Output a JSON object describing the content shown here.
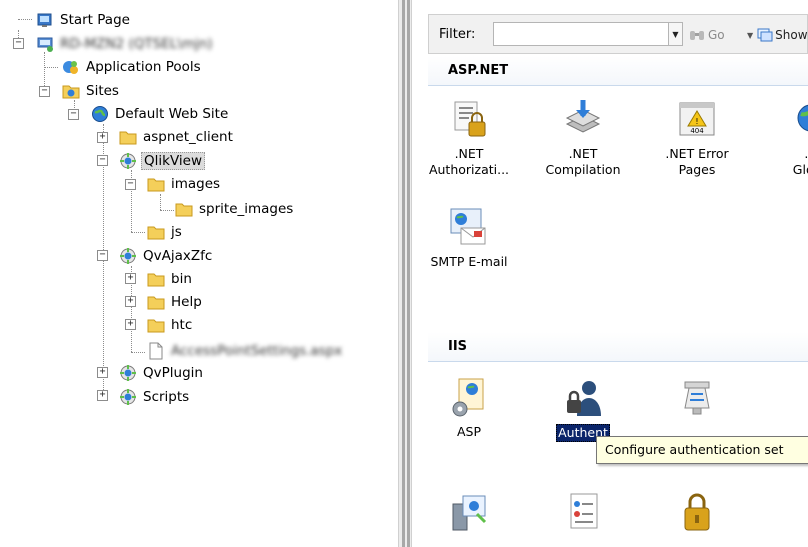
{
  "tree": {
    "items": [
      {
        "label": "Start Page",
        "icon": "start-page-icon"
      },
      {
        "label": "RD-MZN2 (QTSEL\\mjn)",
        "icon": "server-icon",
        "blurred": true
      },
      {
        "label": "Application Pools",
        "icon": "app-pools-icon"
      },
      {
        "label": "Sites",
        "icon": "sites-folder-icon"
      },
      {
        "label": "Default Web Site",
        "icon": "globe-icon"
      },
      {
        "label": "aspnet_client",
        "icon": "folder-icon"
      },
      {
        "label": "QlikView",
        "icon": "web-app-icon"
      },
      {
        "label": "images",
        "icon": "folder-icon"
      },
      {
        "label": "sprite_images",
        "icon": "folder-icon"
      },
      {
        "label": "js",
        "icon": "folder-icon"
      },
      {
        "label": "QvAjaxZfc",
        "icon": "web-app-icon"
      },
      {
        "label": "bin",
        "icon": "folder-icon"
      },
      {
        "label": "Help",
        "icon": "folder-icon"
      },
      {
        "label": "htc",
        "icon": "folder-icon"
      },
      {
        "label": "AccessPointSettings.aspx",
        "icon": "file-icon",
        "blurred": true
      },
      {
        "label": "QvPlugin",
        "icon": "web-app-icon"
      },
      {
        "label": "Scripts",
        "icon": "web-app-icon"
      }
    ]
  },
  "filter": {
    "label": "Filter:",
    "value": "",
    "go_label": "Go",
    "show_label": "Show"
  },
  "groups": {
    "aspnet": {
      "title": "ASP.NET",
      "features": [
        {
          "label1": ".NET",
          "label2": "Authorizati...",
          "icon": "authorization-rules-icon"
        },
        {
          "label1": ".NET",
          "label2": "Compilation",
          "icon": "compilation-icon"
        },
        {
          "label1": ".NET Error",
          "label2": "Pages",
          "icon": "error-pages-icon"
        },
        {
          "label1": ".N",
          "label2": "Globa",
          "icon": "globalization-icon"
        },
        {
          "label1": "SMTP E-mail",
          "label2": "",
          "icon": "smtp-email-icon"
        }
      ]
    },
    "iis": {
      "title": "IIS",
      "features": [
        {
          "label1": "ASP",
          "icon": "asp-icon"
        },
        {
          "label1": "Authent",
          "icon": "authentication-icon",
          "selected": true
        },
        {
          "label1": "",
          "icon": "compression-icon"
        },
        {
          "label1": "",
          "icon": "partial-icon"
        },
        {
          "label1": "",
          "icon": "cgi-icon"
        },
        {
          "label1": "",
          "icon": "default-document-icon"
        },
        {
          "label1": "",
          "icon": "ssl-lock-icon"
        }
      ]
    }
  },
  "tooltip": {
    "text": "Configure authentication set"
  },
  "colors": {
    "selection": "#0a246a",
    "tooltip_bg": "#ffffe1",
    "header_border": "#c9d9ec"
  }
}
